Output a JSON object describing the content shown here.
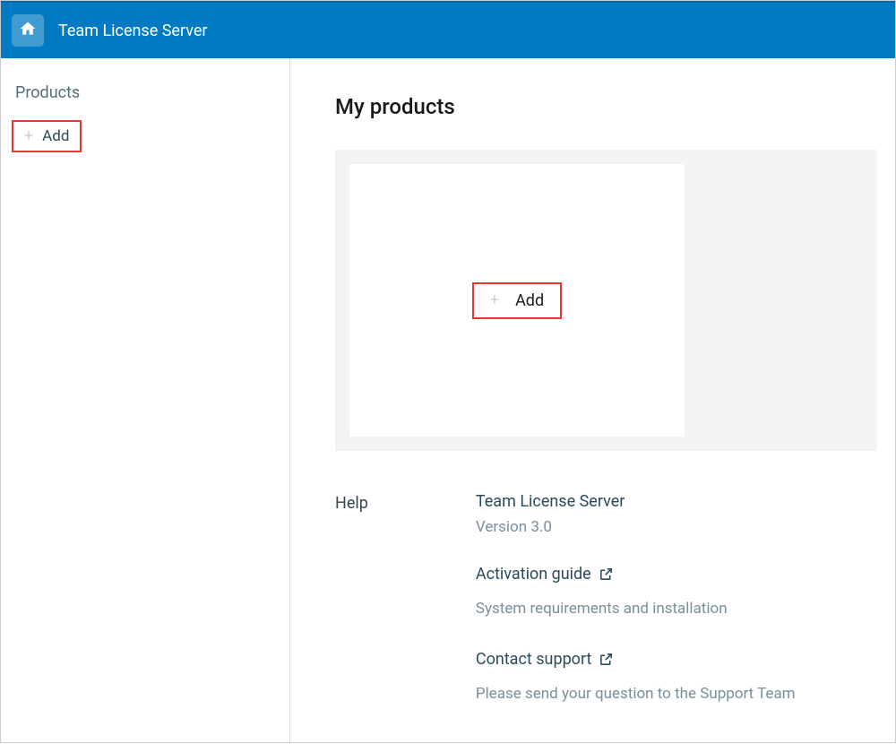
{
  "header": {
    "title": "Team License Server"
  },
  "sidebar": {
    "heading": "Products",
    "add_label": "Add"
  },
  "main": {
    "title": "My products",
    "card_add_label": "Add"
  },
  "help": {
    "heading": "Help",
    "product_name": "Team License Server",
    "version": "Version 3.0",
    "activation_guide": "Activation guide",
    "system_req": "System requirements and installation",
    "contact_support": "Contact support",
    "support_text": "Please send your question to the Support Team"
  }
}
